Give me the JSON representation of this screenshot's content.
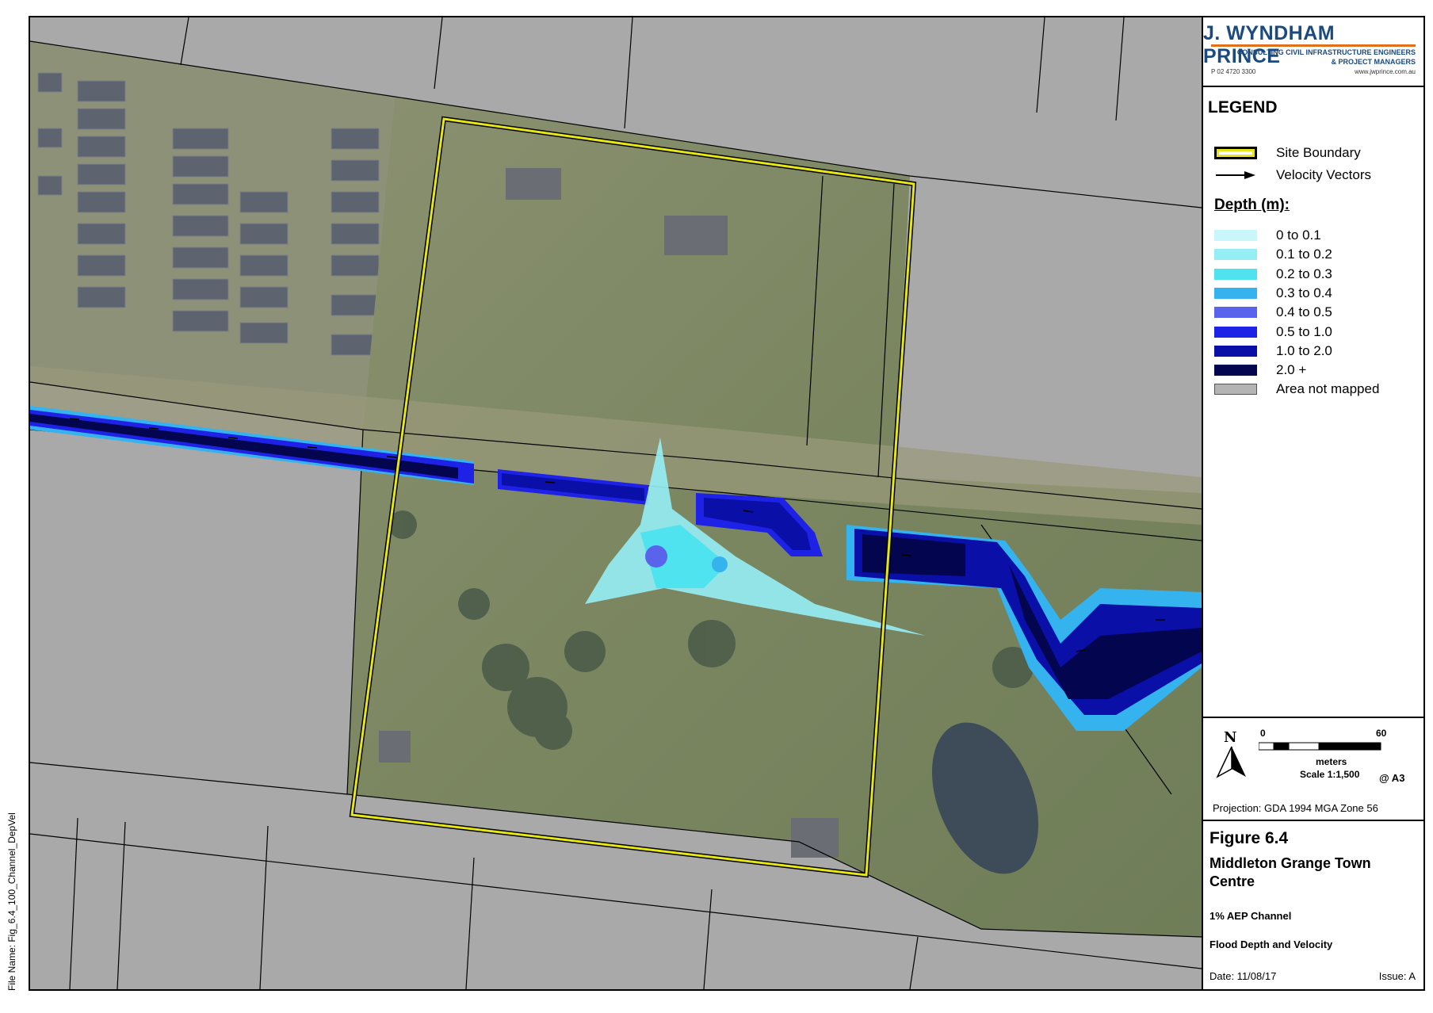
{
  "logo": {
    "name": "J. WYNDHAM PRINCE",
    "line1": "CONSULTING CIVIL INFRASTRUCTURE ENGINEERS",
    "line2": "& PROJECT MANAGERS",
    "phone": "P 02 4720 3300",
    "web": "www.jwprince.com.au"
  },
  "legend": {
    "title": "LEGEND",
    "site_boundary": "Site Boundary",
    "velocity_vectors": "Velocity Vectors",
    "depth_heading": "Depth (m):",
    "depth_classes": [
      {
        "label": "0 to 0.1",
        "color": "#c9f6fa"
      },
      {
        "label": "0.1 to 0.2",
        "color": "#96eef5"
      },
      {
        "label": "0.2 to 0.3",
        "color": "#4fe3f0"
      },
      {
        "label": "0.3 to 0.4",
        "color": "#35b3ee"
      },
      {
        "label": "0.4 to 0.5",
        "color": "#5a63ec"
      },
      {
        "label": "0.5 to 1.0",
        "color": "#1e22e6"
      },
      {
        "label": "1.0 to 2.0",
        "color": "#0a0fa8"
      },
      {
        "label": "2.0 +",
        "color": "#03064f"
      },
      {
        "label": "Area not mapped",
        "color": "#b4b4b4"
      }
    ]
  },
  "scale": {
    "north": "N",
    "start": "0",
    "end": "60",
    "units": "meters",
    "ratio": "Scale 1:1,500",
    "page": "@ A3"
  },
  "projection": "Projection: GDA 1994 MGA Zone 56",
  "figure": {
    "number": "Figure 6.4",
    "title": "Middleton Grange Town Centre",
    "subtitle1": "1% AEP Channel",
    "subtitle2": "Flood Depth and Velocity",
    "date": "Date: 11/08/17",
    "issue": "Issue: A"
  },
  "file_name": "File Name: Fig_6.4_100_Channel_DepVel",
  "colors": {
    "site_boundary": "#e6e61a",
    "unmapped": "#a9a9a9",
    "aerial_grass": "#7d8a5e",
    "roof": "#5d6470",
    "logo_blue": "#1b4a7e",
    "logo_orange": "#e1701c"
  }
}
